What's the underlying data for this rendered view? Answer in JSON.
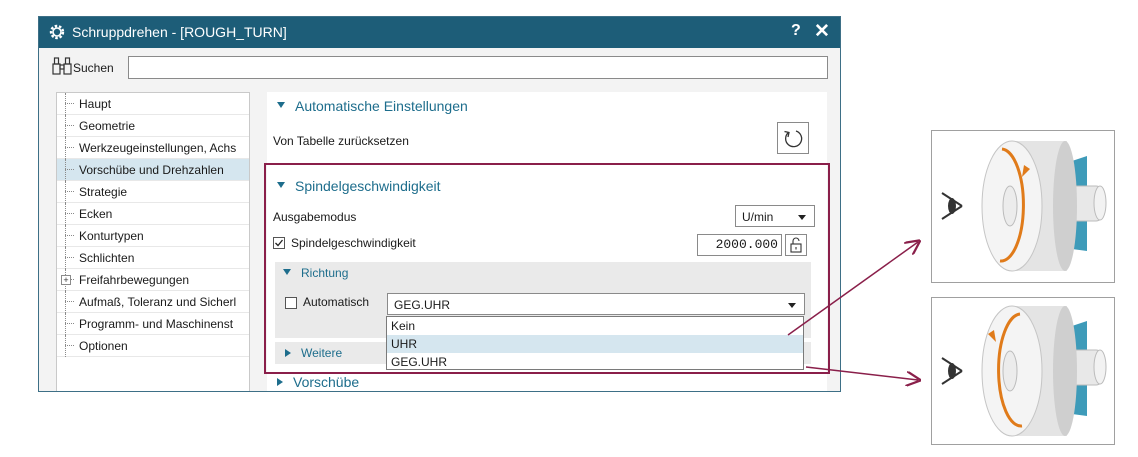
{
  "dialog": {
    "title": "Schruppdrehen - [ROUGH_TURN]",
    "help_label": "?",
    "close_label": "✕"
  },
  "search": {
    "label": "Suchen",
    "value": ""
  },
  "tree": {
    "items": [
      {
        "label": "Haupt"
      },
      {
        "label": "Geometrie"
      },
      {
        "label": "Werkzeugeinstellungen, Achs"
      },
      {
        "label": "Vorschübe und Drehzahlen",
        "selected": true
      },
      {
        "label": "Strategie"
      },
      {
        "label": "Ecken"
      },
      {
        "label": "Konturtypen"
      },
      {
        "label": "Schlichten"
      },
      {
        "label": "Freifahrbewegungen",
        "expandable": true,
        "expander": "+"
      },
      {
        "label": "Aufmaß, Toleranz und Sicherl"
      },
      {
        "label": "Programm- und Maschinenst"
      },
      {
        "label": "Optionen"
      }
    ]
  },
  "panel": {
    "auto_settings": {
      "title": "Automatische Einstellungen",
      "reset_label": "Von Tabelle zurücksetzen"
    },
    "spindle": {
      "title": "Spindelgeschwindigkeit",
      "output_mode_label": "Ausgabemodus",
      "output_mode_value": "U/min",
      "speed_checkbox_label": "Spindelgeschwindigkeit",
      "speed_checked": true,
      "speed_value": "2000.000",
      "direction": {
        "title": "Richtung",
        "auto_label": "Automatisch",
        "auto_checked": false,
        "selected": "GEG.UHR",
        "options": [
          "Kein",
          "UHR",
          "GEG.UHR"
        ],
        "highlighted_option": "UHR"
      },
      "more_title": "Weitere"
    },
    "feeds_title": "Vorschübe"
  },
  "colors": {
    "title_bar": "#1d5d78",
    "accent": "#1d6d8c",
    "highlight_box": "#8a1f4a",
    "selection": "#d5e6ef",
    "arrow_orange": "#e07b1a"
  }
}
